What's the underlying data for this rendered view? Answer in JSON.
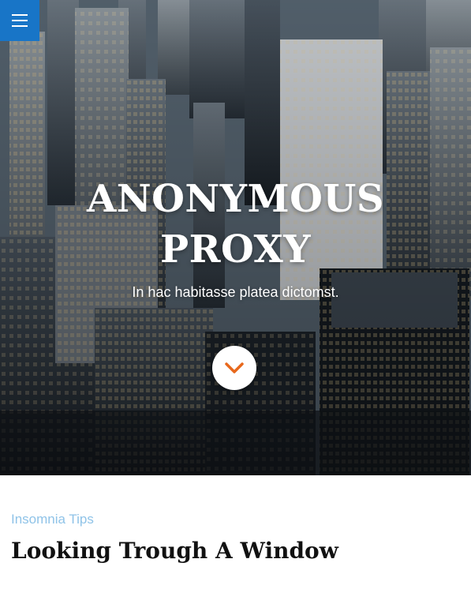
{
  "header": {
    "menu_icon": "hamburger-menu-icon",
    "accent_color": "#1875c7"
  },
  "hero": {
    "title_line1": "ANONYMOUS",
    "title_line2": "PROXY",
    "subtitle": "In hac habitasse platea dictomst.",
    "scroll_icon": "chevron-down-icon",
    "scroll_icon_color": "#e8681c",
    "background": "city-skyline-photo"
  },
  "post": {
    "category": "Insomnia Tips",
    "category_color": "#8fc3e8",
    "title": "Looking Trough A Window"
  }
}
